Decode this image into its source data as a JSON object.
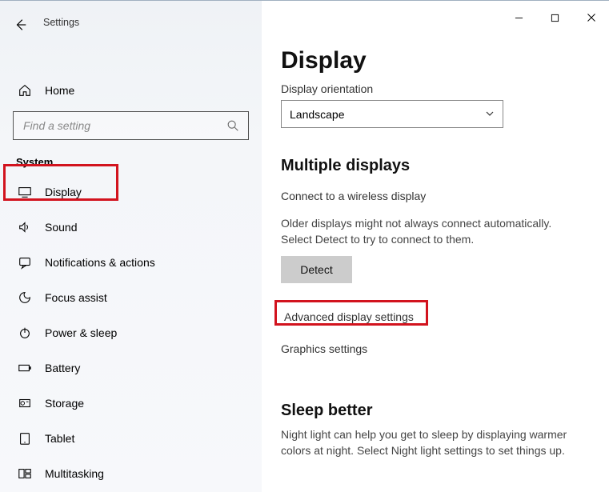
{
  "window": {
    "title": "Settings"
  },
  "sidebar": {
    "home": "Home",
    "search_placeholder": "Find a setting",
    "category": "System",
    "items": [
      {
        "label": "Display"
      },
      {
        "label": "Sound"
      },
      {
        "label": "Notifications & actions"
      },
      {
        "label": "Focus assist"
      },
      {
        "label": "Power & sleep"
      },
      {
        "label": "Battery"
      },
      {
        "label": "Storage"
      },
      {
        "label": "Tablet"
      },
      {
        "label": "Multitasking"
      }
    ]
  },
  "main": {
    "title": "Display",
    "orientation_label": "Display orientation",
    "orientation_value": "Landscape",
    "multi_title": "Multiple displays",
    "connect_link": "Connect to a wireless display",
    "older_text": "Older displays might not always connect automatically. Select Detect to try to connect to them.",
    "detect_label": "Detect",
    "advanced_link": "Advanced display settings",
    "graphics_link": "Graphics settings",
    "sleep_title": "Sleep better",
    "sleep_text": "Night light can help you get to sleep by displaying warmer colors at night. Select Night light settings to set things up."
  }
}
